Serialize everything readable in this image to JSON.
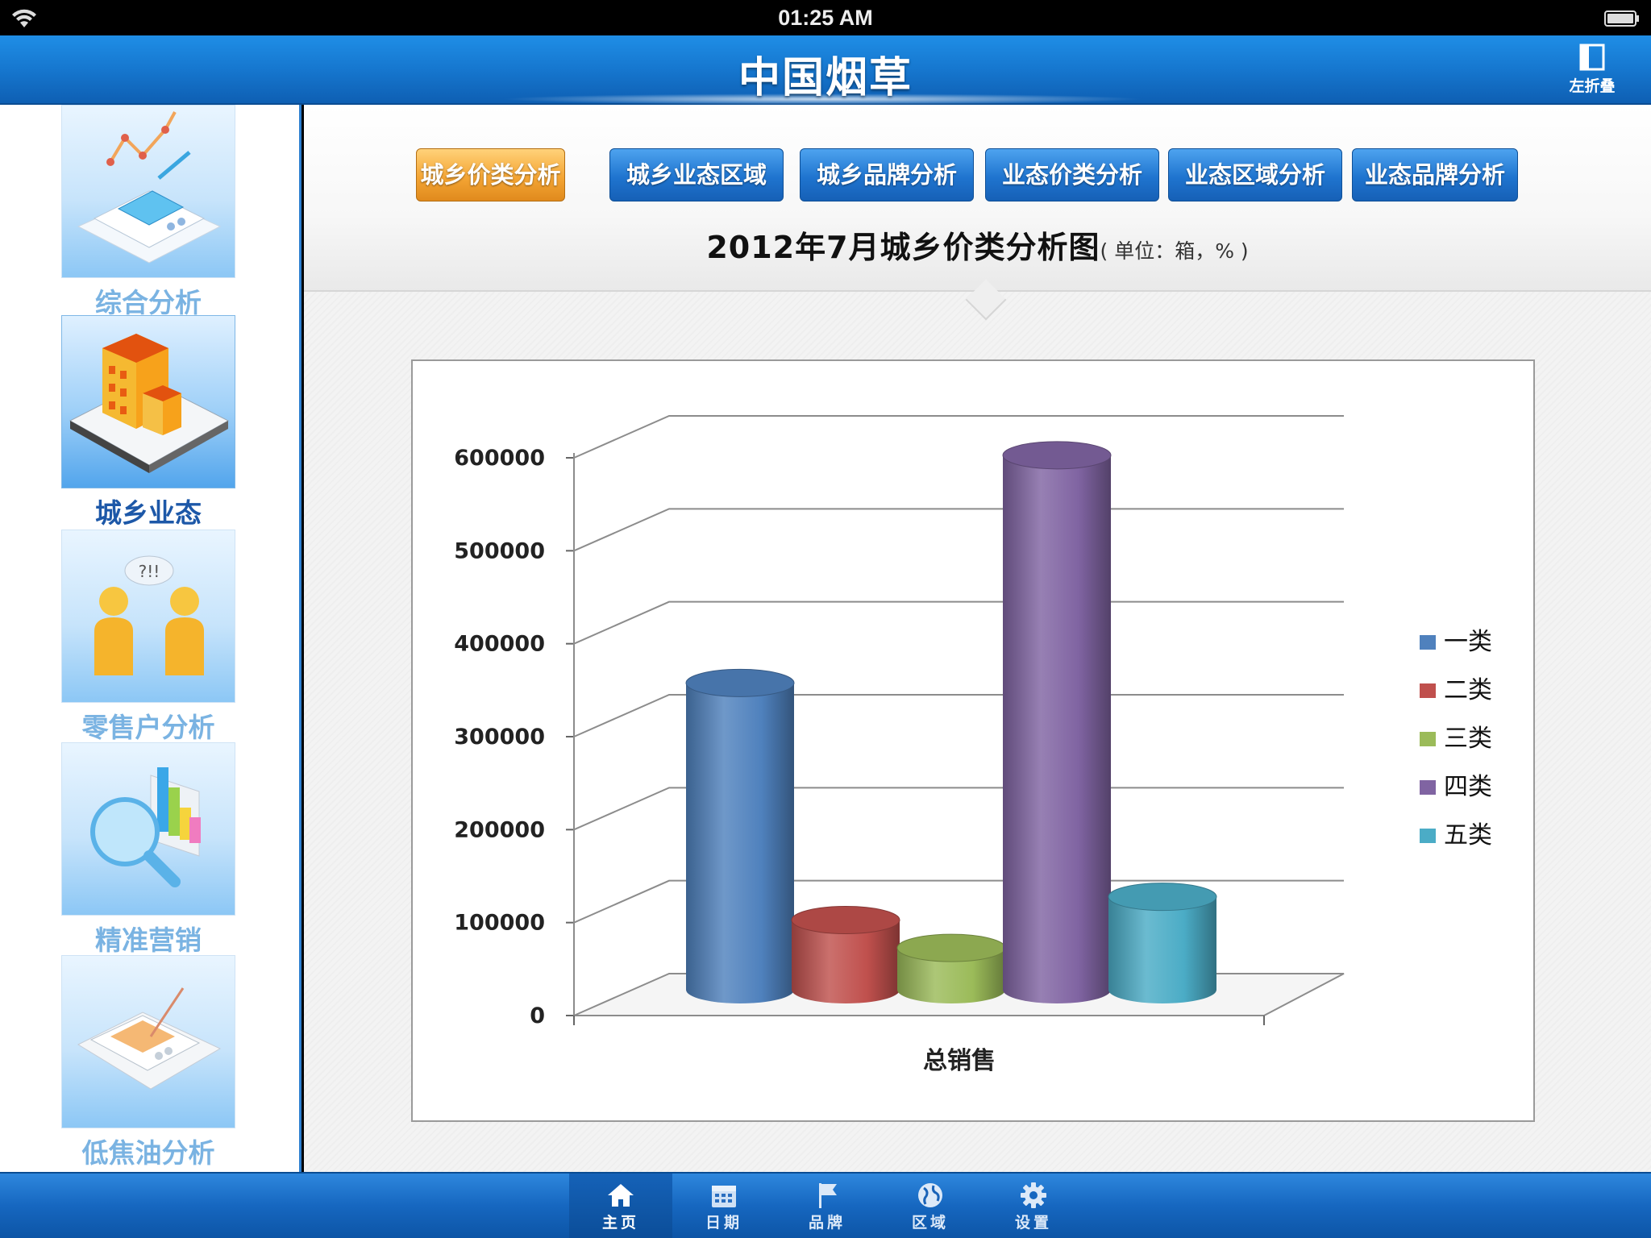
{
  "status_bar": {
    "time": "01:25 AM"
  },
  "nav": {
    "title": "中国烟草",
    "fold_label": "左折叠"
  },
  "sidebar": {
    "items": [
      {
        "label": "综合分析",
        "active": false
      },
      {
        "label": "城乡业态",
        "active": true
      },
      {
        "label": "零售户分析",
        "active": false
      },
      {
        "label": "精准营销",
        "active": false
      },
      {
        "label": "低焦油分析",
        "active": false
      }
    ],
    "speech_bubble": "?!!"
  },
  "tabs": [
    {
      "label": "城乡价类分析",
      "active": true
    },
    {
      "label": "城乡业态区域",
      "active": false
    },
    {
      "label": "城乡品牌分析",
      "active": false
    },
    {
      "label": "业态价类分析",
      "active": false
    },
    {
      "label": "业态区域分析",
      "active": false
    },
    {
      "label": "业态品牌分析",
      "active": false
    }
  ],
  "chart_title": {
    "main": "2012年7月城乡价类分析图",
    "unit": "( 单位：箱，% )"
  },
  "chart_data": {
    "type": "bar",
    "style": "3d-cylinder",
    "categories": [
      "总销售"
    ],
    "series": [
      {
        "name": "一类",
        "values": [
          330000
        ],
        "color": "#4f81bd"
      },
      {
        "name": "二类",
        "values": [
          75000
        ],
        "color": "#c0504d"
      },
      {
        "name": "三类",
        "values": [
          45000
        ],
        "color": "#9bbb59"
      },
      {
        "name": "四类",
        "values": [
          575000
        ],
        "color": "#8064a2"
      },
      {
        "name": "五类",
        "values": [
          100000
        ],
        "color": "#4bacc6"
      }
    ],
    "ylim": [
      0,
      600000
    ],
    "yticks": [
      "0",
      "100000",
      "200000",
      "300000",
      "400000",
      "500000",
      "600000"
    ],
    "grid": true,
    "legend": "right"
  },
  "tab_bar": {
    "items": [
      {
        "label": "主页",
        "icon": "home-icon",
        "active": true
      },
      {
        "label": "日期",
        "icon": "calendar-icon",
        "active": false
      },
      {
        "label": "品牌",
        "icon": "flag-icon",
        "active": false
      },
      {
        "label": "区域",
        "icon": "globe-icon",
        "active": false
      },
      {
        "label": "设置",
        "icon": "gear-icon",
        "active": false
      }
    ]
  }
}
